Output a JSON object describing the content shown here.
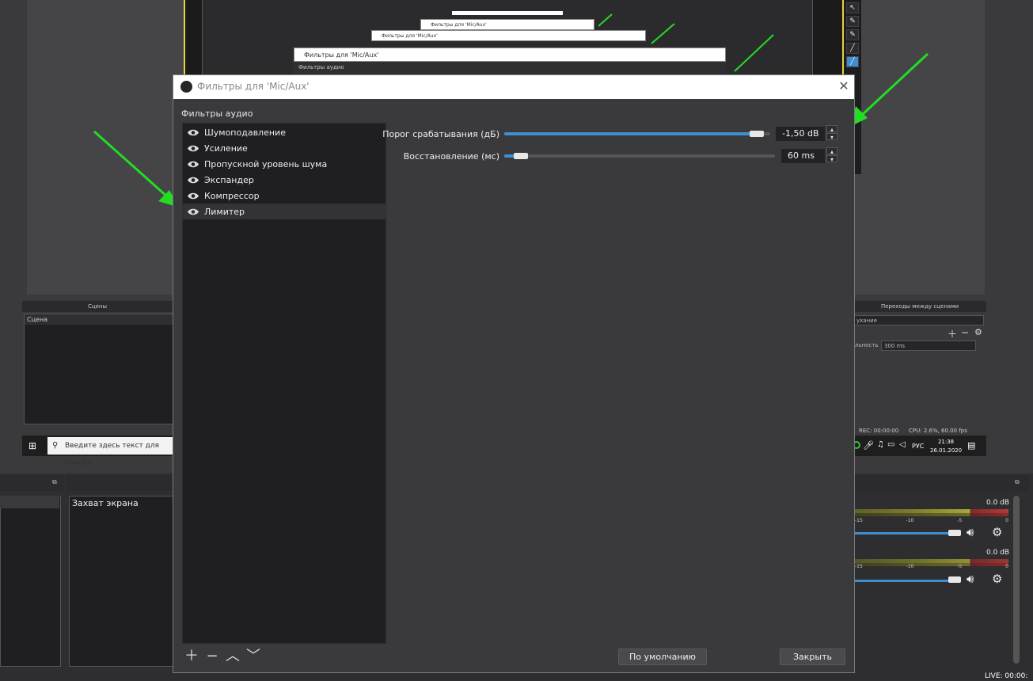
{
  "background": {
    "nested_titles": [
      "Фильтры для 'Mic/Aux'",
      "Фильтры для 'Mic/Aux'"
    ],
    "nested_section": "Фильтры аудио",
    "scenes_header": "Сцены",
    "scene_list_header": "Сцена",
    "transitions_header": "Переходы между сценами",
    "transition_select": "ухание",
    "duration_label": "льность",
    "duration_value": "300 ms",
    "status_rec": "REC: 00:00:00",
    "status_cpu": "CPU: 2.6%, 60.00 fps",
    "taskbar_search": "Введите здесь текст для поиска",
    "tray_lang": "РУС",
    "tray_time": "21:38",
    "tray_date": "26.01.2020",
    "source_label": "Захват экрана",
    "mixer": [
      {
        "db": "0.0 dB",
        "ticks": [
          "-15",
          "-10",
          "-5",
          "0"
        ]
      },
      {
        "db": "0.0 dB",
        "ticks": [
          "-15",
          "-10",
          "-5",
          "0"
        ]
      }
    ],
    "live": "LIVE: 00:00:"
  },
  "dialog": {
    "title": "Фильтры для 'Mic/Aux'",
    "section_label": "Фильтры аудио",
    "filters": [
      {
        "label": "Шумоподавление"
      },
      {
        "label": "Усиление"
      },
      {
        "label": "Пропускной уровень шума"
      },
      {
        "label": "Экспандер"
      },
      {
        "label": "Компрессор"
      },
      {
        "label": "Лимитер"
      }
    ],
    "selected_index": 5,
    "properties": [
      {
        "label": "Порог срабатывания (дБ)",
        "value": "-1,50 dB",
        "level": 0.95
      },
      {
        "label": "Восстановление (мс)",
        "value": "60 ms",
        "level": 0.06
      }
    ],
    "defaults_button": "По умолчанию",
    "close_button": "Закрыть"
  },
  "colors": {
    "accent": "#3e8ed0",
    "arrow": "#22dd22",
    "preview_border": "#e4d43a"
  }
}
